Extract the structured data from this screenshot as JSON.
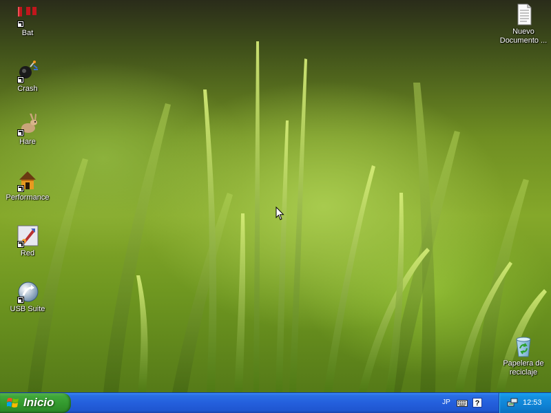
{
  "desktop": {
    "icons_left": [
      {
        "id": "bat",
        "label": "Bat",
        "icon": "bat-icon"
      },
      {
        "id": "crash",
        "label": "Crash",
        "icon": "crash-icon"
      },
      {
        "id": "hare",
        "label": "Hare",
        "icon": "hare-icon"
      },
      {
        "id": "performance",
        "label": "Performance",
        "icon": "performance-icon"
      },
      {
        "id": "red",
        "label": "Red",
        "icon": "red-icon"
      },
      {
        "id": "usb_suite",
        "label": "USB Suite",
        "icon": "usb-suite-icon"
      }
    ],
    "icons_right": [
      {
        "id": "nuevo_documento",
        "label": "Nuevo\nDocumento ...",
        "icon": "text-document-icon"
      },
      {
        "id": "papelera",
        "label": "Papelera de\nreciclaje",
        "icon": "recycle-bin-icon"
      }
    ]
  },
  "taskbar": {
    "start_label": "Inicio",
    "language": "JP",
    "help_glyph": "?",
    "clock": "12:53"
  },
  "colors": {
    "taskbar_blue": "#245fdc",
    "start_green": "#3fa83a",
    "systray_blue": "#0f83d5"
  }
}
